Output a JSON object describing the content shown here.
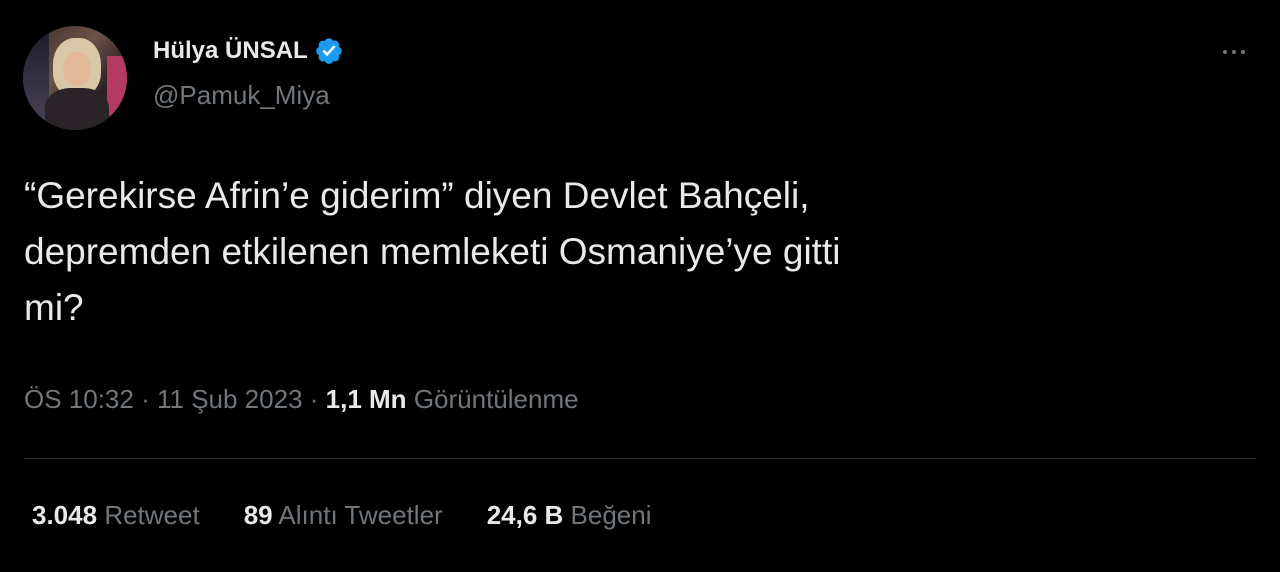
{
  "author": {
    "display_name": "Hülya ÜNSAL",
    "handle": "@Pamuk_Miya",
    "verified_color": "#1d9bf0"
  },
  "tweet": {
    "text_line1": "“Gerekirse Afrin’e giderim” diyen Devlet Bahçeli,",
    "text_line2": "depremden etkilenen memleketi Osmaniye’ye gitti",
    "text_line3": "mi?"
  },
  "meta": {
    "time": "ÖS 10:32",
    "date": "11 Şub 2023",
    "views_count": "1,1 Mn",
    "views_label": "Görüntülenme"
  },
  "stats": {
    "retweets_count": "3.048",
    "retweets_label": "Retweet",
    "quotes_count": "89",
    "quotes_label": "Alıntı Tweetler",
    "likes_count": "24,6 B",
    "likes_label": "Beğeni"
  }
}
